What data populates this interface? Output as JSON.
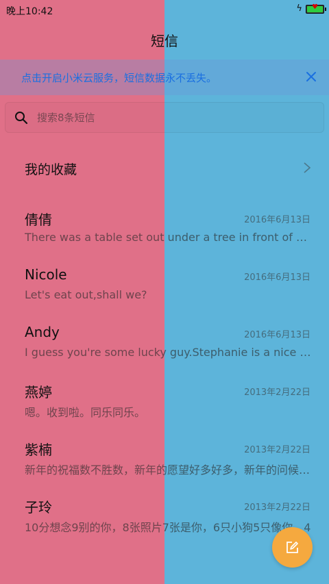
{
  "status_bar": {
    "time": "晚上10:42",
    "charging_icon": "lightning-icon",
    "battery_icon": "battery-icon"
  },
  "header": {
    "title": "短信"
  },
  "banner": {
    "text": "点击开启小米云服务，短信数据永不丢失。",
    "close_icon": "close-icon",
    "text_color": "#1a6fe0"
  },
  "search": {
    "placeholder": "搜索8条短信",
    "value": "",
    "icon": "search-icon"
  },
  "favorites": {
    "label": "我的收藏",
    "icon": "chevron-right-icon"
  },
  "threads": [
    {
      "name": "倩倩",
      "date": "2016年6月13日",
      "preview": "There was a table set out under a tree in front of the house"
    },
    {
      "name": "Nicole",
      "date": "2016年6月13日",
      "preview": "Let's eat out,shall we?"
    },
    {
      "name": "Andy",
      "date": "2016年6月13日",
      "preview": "I guess you're some lucky guy.Stephanie is a nice girl."
    },
    {
      "name": "燕婷",
      "date": "2013年2月22日",
      "preview": "嗯。收到啦。同乐同乐。"
    },
    {
      "name": "紫楠",
      "date": "2013年2月22日",
      "preview": "新年的祝福数不胜数，新年的愿望好多好多，新年的问候一句句"
    },
    {
      "name": "子玲",
      "date": "2013年2月22日",
      "preview": "10分想念9别的你，8张照片7张是你，6只小狗5只像你，4"
    }
  ],
  "fab": {
    "icon": "compose-icon",
    "color": "#f5a93f"
  },
  "colors": {
    "left_background": "#e07088",
    "right_background": "#5db4da"
  }
}
